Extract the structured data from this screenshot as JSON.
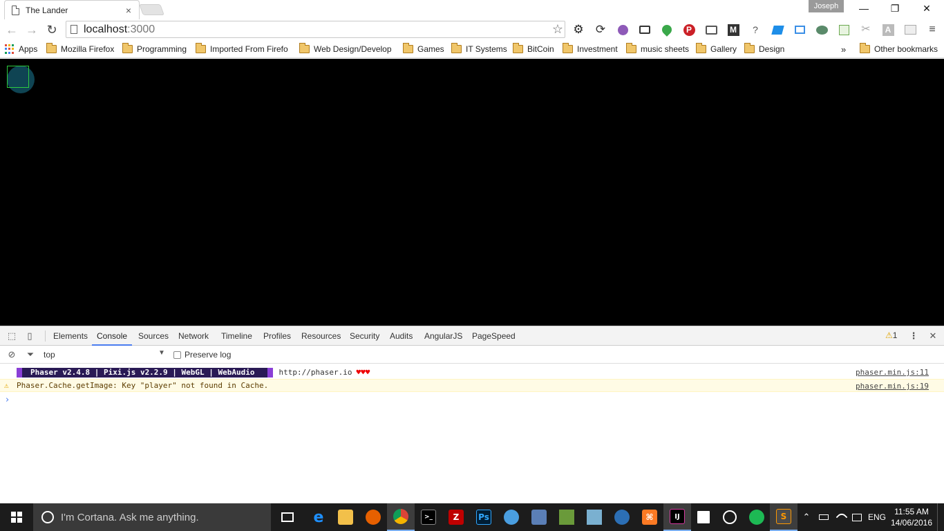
{
  "browser": {
    "tab_title": "The Lander",
    "tab_close": "×",
    "profile_name": "Joseph",
    "window_controls": {
      "minimize": "—",
      "restore": "❐",
      "close": "✕"
    },
    "nav": {
      "back": "←",
      "forward": "→",
      "reload": "↻"
    },
    "address": {
      "host": "localhost",
      "port": ":3000",
      "star": "☆"
    },
    "extensions": [
      "gear-icon",
      "sync-icon",
      "onion-icon",
      "bus-icon",
      "pin-icon",
      "pinterest-icon",
      "cast-icon",
      "m-icon",
      "bookmark-question-icon",
      "flag-icon",
      "folder-icon",
      "bot-icon",
      "sheet-icon",
      "tools-icon",
      "font-icon",
      "grid-icon",
      "menu-icon"
    ]
  },
  "bookmarks": {
    "apps_label": "Apps",
    "items": [
      "Mozilla Firefox",
      "Programming",
      "Imported From Firefo",
      "Web Design/Develop",
      "Games",
      "IT Systems",
      "BitCoin",
      "Investment",
      "music sheets",
      "Gallery",
      "Design"
    ],
    "overflow": "»",
    "other": "Other bookmarks"
  },
  "game": {
    "background": "#000000",
    "sprite_color": "#0f4453",
    "bounds_color": "#2ecc40"
  },
  "devtools": {
    "tabs": [
      "Elements",
      "Console",
      "Sources",
      "Network",
      "Timeline",
      "Profiles",
      "Resources",
      "Security",
      "Audits",
      "AngularJS",
      "PageSpeed"
    ],
    "active_tab": "Console",
    "warning_count": "1",
    "more_label": "⋮",
    "close_label": "✕",
    "context": "top",
    "preserve_log": "Preserve log",
    "banner": {
      "text": "Phaser v2.4.8 | Pixi.js v2.2.9 | WebGL | WebAudio",
      "url": "http://phaser.io",
      "hearts": "♥♥♥",
      "source": "phaser.min.js:11"
    },
    "warning": {
      "text": "Phaser.Cache.getImage: Key \"player\" not found in Cache.",
      "source": "phaser.min.js:19"
    },
    "prompt": "›"
  },
  "taskbar": {
    "cortana_placeholder": "I'm Cortana. Ask me anything.",
    "language": "ENG",
    "time": "11:55 AM",
    "date": "14/06/2016"
  }
}
